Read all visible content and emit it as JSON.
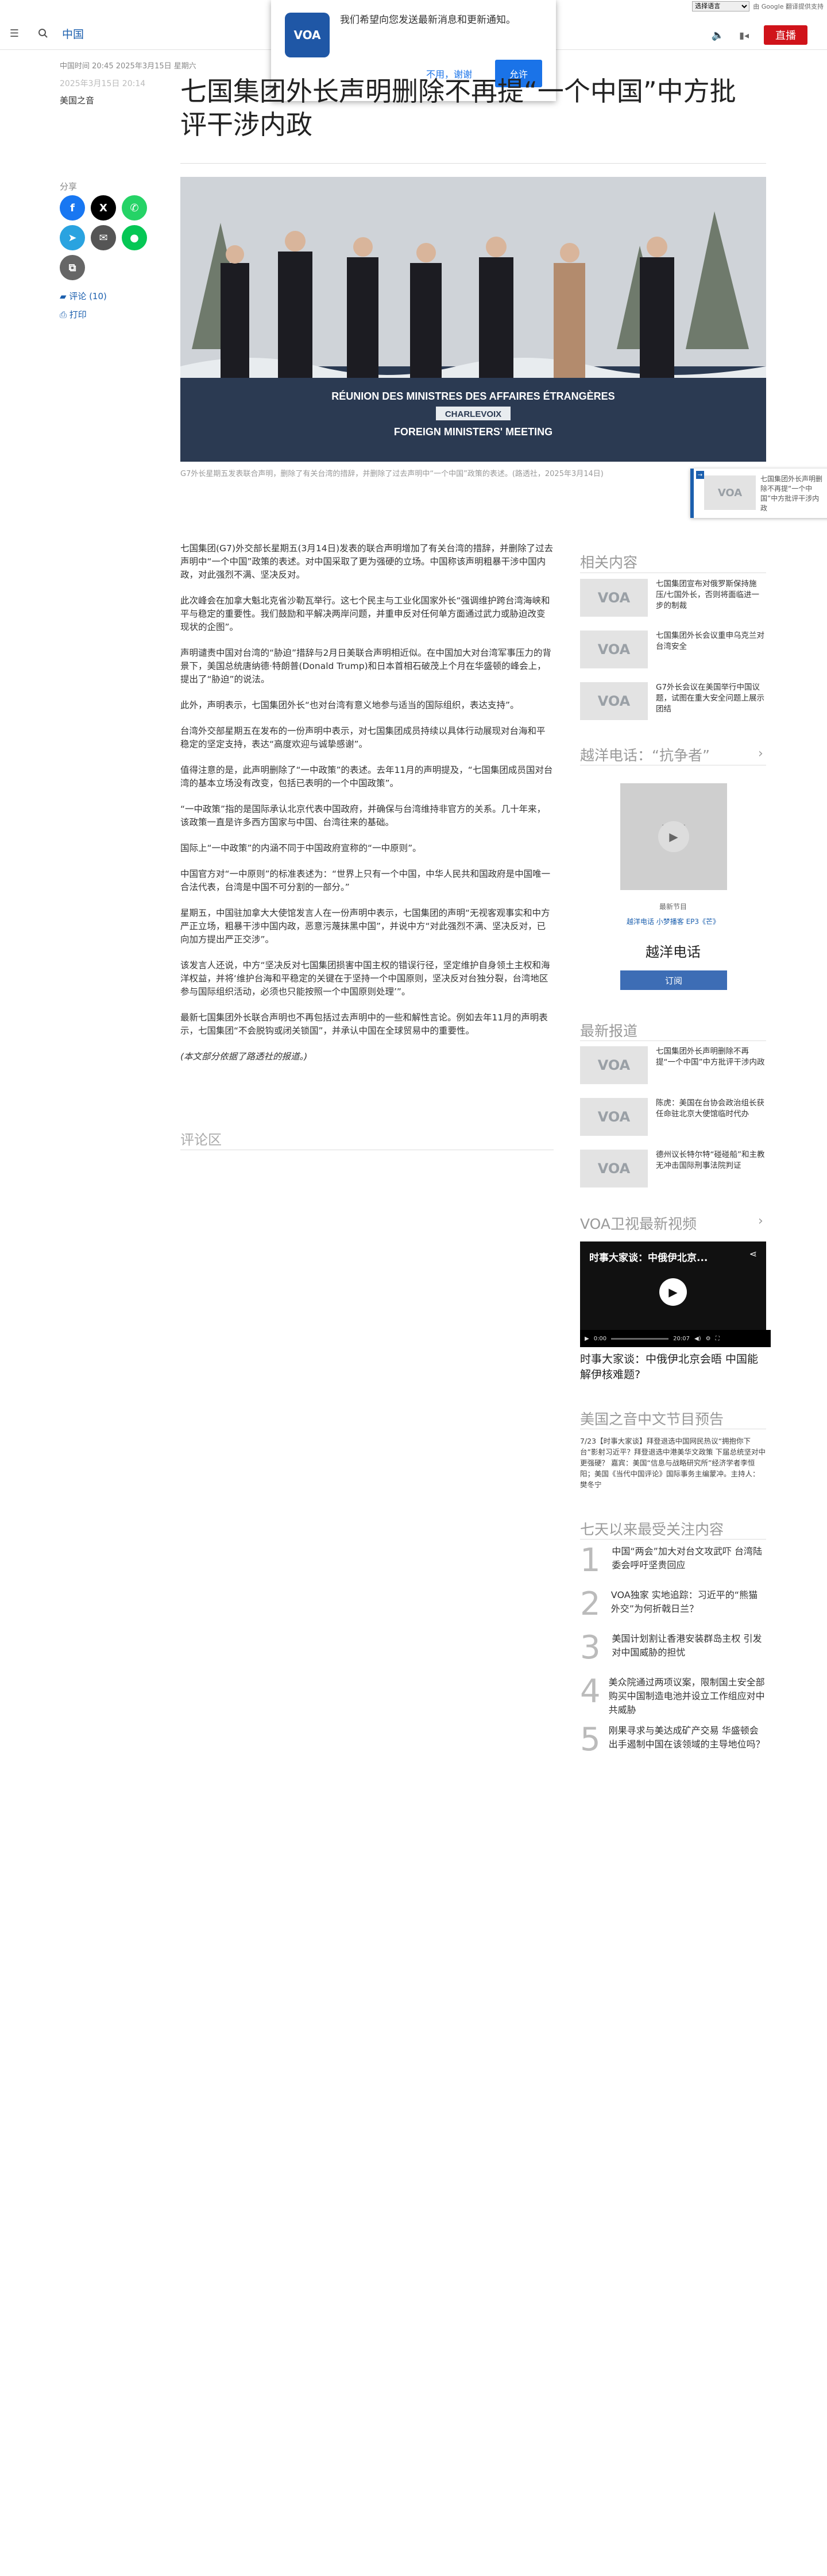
{
  "translate": {
    "select_label": "选择语言",
    "powered": "由 Google 翻译提供支持"
  },
  "header": {
    "brand": "中国",
    "live_label": "直播"
  },
  "popup": {
    "message": "我们希望向您发送最新消息和更新通知。",
    "no_label": "不用，谢谢",
    "yes_label": "允许",
    "logo_text": "VOA"
  },
  "article": {
    "updated": "中国时间 20:45 2025年3月15日 星期六",
    "date": "2025年3月15日 20:14",
    "author": "美国之音",
    "title": "七国集团外长声明删除不再提“一个中国”中方批评干涉内政",
    "share_label": "分享",
    "comments_label": "评论 (10)",
    "print_label": "打印",
    "photo_banner_1": "RÉUNION DES MINISTRES DES AFFAIRES ÉTRANGÈRES",
    "photo_banner_2": "CHARLEVOIX",
    "photo_banner_3": "FOREIGN MINISTERS' MEETING",
    "caption": "G7外长星期五发表联合声明，删除了有关台湾的措辞，并删除了过去声明中“一个中国”政策的表述。(路透社，2025年3月14日)",
    "paragraphs": [
      "七国集团(G7)外交部长星期五(3月14日)发表的联合声明增加了有关台湾的措辞，并删除了过去声明中“一个中国”政策的表述。对中国采取了更为强硬的立场。中国称该声明粗暴干涉中国内政，对此强烈不满、坚决反对。",
      "此次峰会在加拿大魁北克省沙勒瓦举行。这七个民主与工业化国家外长“强调维护跨台湾海峡和平与稳定的重要性。我们鼓励和平解决两岸问题，并重申反对任何单方面通过武力或胁迫改变现状的企图”。",
      "声明谴责中国对台湾的“胁迫”措辞与2月日美联合声明相近似。在中国加大对台湾军事压力的背景下，美国总统唐纳德·特朗普(Donald Trump)和日本首相石破茂上个月在华盛顿的峰会上，提出了“胁迫”的说法。",
      "此外，声明表示，七国集团外长“也对台湾有意义地参与适当的国际组织，表达支持”。",
      "台湾外交部星期五在发布的一份声明中表示，对七国集团成员持续以具体行动展现对台海和平稳定的坚定支持，表达“高度欢迎与诚挚感谢”。",
      "值得注意的是，此声明删除了“一中政策”的表述。去年11月的声明提及，“七国集团成员国对台湾的基本立场没有改变，包括已表明的一个中国政策”。",
      "“一中政策”指的是国际承认北京代表中国政府，并确保与台湾维持非官方的关系。几十年来，该政策一直是许多西方国家与中国、台湾往来的基础。",
      "国际上“一中政策”的内涵不同于中国政府宣称的“一中原则”。",
      "中国官方对“一中原则”的标准表述为：“世界上只有一个中国，中华人民共和国政府是中国唯一合法代表，台湾是中国不可分割的一部分。”",
      "星期五，中国驻加拿大大使馆发言人在一份声明中表示，七国集团的声明“无视客观事实和中方严正立场，粗暴干涉中国内政，恶意污蔑抹黑中国”，并说中方“对此强烈不满、坚决反对，已向加方提出严正交涉”。",
      "该发言人还说，中方“坚决反对七国集团损害中国主权的错误行径，坚定维护自身领土主权和海洋权益，并将‘维护台海和平稳定的关键在于坚持一个中国原则，坚决反对台独分裂，台湾地区参与国际组织活动，必须也只能按照一个中国原则处理’”。",
      "最新七国集团外长联合声明也不再包括过去声明中的一些和解性言论。例如去年11月的声明表示，七国集团“不会脱钩或闭关锁国”，并承认中国在全球贸易中的重要性。"
    ],
    "source_note": "(本文部分依据了路透社的报道。)",
    "comments_heading": "评论区"
  },
  "sidebar": {
    "related_heading": "相关内容",
    "related": [
      "七国集团宣布对俄罗斯保持施压/七国外长，否则将面临进一步的制裁",
      "七国集团外长会议重申乌克兰对台湾安全",
      "G7外长会议在美国举行中国议题，试图在重大安全问题上展示团结"
    ],
    "podcast_heading": "越洋电话：“抗争者”",
    "podcast_caption": "最新节目",
    "podcast_links": "越洋电话   小梦播客   EP3《芒》",
    "podcast_title": "越洋电话",
    "subscribe_label": "订阅",
    "latest_heading": "最新报道",
    "latest": [
      "七国集团外长声明删除不再提“一个中国”中方批评干涉内政",
      "陈虎：美国在台协会政治组长获任命驻北京大使馆临时代办",
      "德州议长特尔特“碰碰船”和主教无冲击国际刑事法院判证"
    ],
    "video_heading": "VOA卫视最新视频",
    "video_overlay_title": "时事大家谈：中俄伊北京...",
    "video_time": "0:00",
    "video_duration": "20:07",
    "video_title": "时事大家谈：中俄伊北京会晤 中国能解伊核难题?",
    "preview_heading": "美国之音中文节目预告",
    "preview_text": "7/23【时事大家谈】拜登退选中国网民热议“拥抱你下台”影射习近平？拜登退选中港美华文政策 下届总统坚对中更强硬？ 嘉宾：美国“信息与战略研究所”经济学者李恒阳；美国《当代中国评论》国际事务主编蒙冲。主持人：樊冬宁",
    "top_heading": "七天以来最受关注内容",
    "top": [
      {
        "num": "1",
        "text": "中国“两会”加大对台文攻武吓 台湾陆委会呼吁坚贵回应"
      },
      {
        "num": "2",
        "text": "VOA独家 实地追踪：习近平的“熊猫外交”为何折戟日兰？"
      },
      {
        "num": "3",
        "text": "美国计划割让香港安装群岛主权 引发对中国威胁的担忧"
      },
      {
        "num": "4",
        "text": "美众院通过两项议案，限制国土安全部购买中国制造电池并设立工作组应对中共威胁"
      },
      {
        "num": "5",
        "text": "刚果寻求与美达成矿产交易 华盛顿会出手遏制中国在该领域的主导地位吗？"
      }
    ],
    "float_tab_text": "七国集团外长声明删除不再提“一个中国”中方批评干涉内政"
  },
  "colors": {
    "brand_blue": "#1b5fae",
    "live_red": "#d0131a",
    "popup_button": "#1a73e8"
  },
  "icons": {
    "menu": "menu-icon",
    "search": "search-icon",
    "audio": "audio-icon",
    "video": "video-icon"
  }
}
